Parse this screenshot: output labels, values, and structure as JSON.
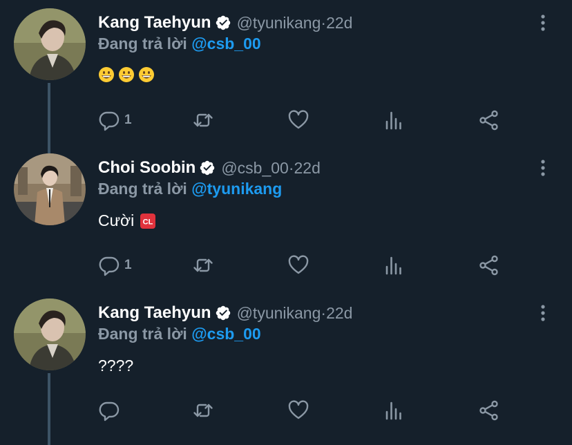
{
  "colors": {
    "background": "#15202b",
    "text_primary": "#ffffff",
    "text_secondary": "#8b98a5",
    "mention": "#1d9bf0",
    "thread_line": "#3d5466"
  },
  "tweets": [
    {
      "name": "Kang Taehyun",
      "handle": "@tyunikang",
      "time": "22d",
      "reply_label": "Đang trả lời",
      "reply_to": "@csb_00",
      "text": "",
      "emojis": [
        "grinning-face",
        "grinning-face",
        "grinning-face"
      ],
      "reply_count": "1"
    },
    {
      "name": "Choi Soobin",
      "handle": "@csb_00",
      "time": "22d",
      "reply_label": "Đang trả lời",
      "reply_to": "@tyunikang",
      "text": "Cười",
      "emojis": [
        "cl-button"
      ],
      "reply_count": "1"
    },
    {
      "name": "Kang Taehyun",
      "handle": "@tyunikang",
      "time": "22d",
      "reply_label": "Đang trả lời",
      "reply_to": "@csb_00",
      "text": "????",
      "emojis": [],
      "reply_count": ""
    }
  ],
  "separator": " · ",
  "icons": {
    "verified": "verified-badge-icon",
    "more": "more-vertical-icon",
    "reply": "reply-icon",
    "retweet": "retweet-icon",
    "like": "heart-icon",
    "analytics": "analytics-icon",
    "share": "share-icon"
  }
}
